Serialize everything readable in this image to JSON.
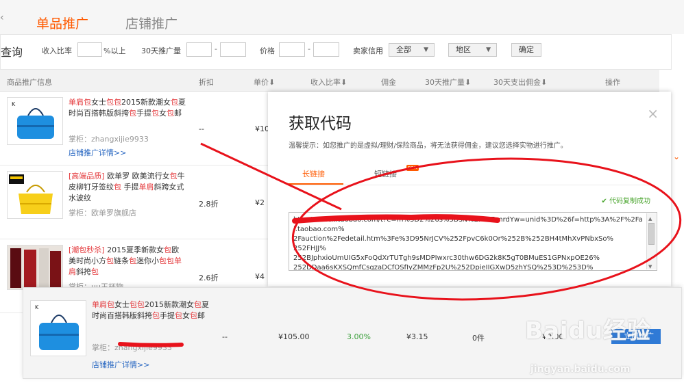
{
  "tabs": {
    "active": "单品推广",
    "inactive": "店铺推广"
  },
  "filters": {
    "query": "查询",
    "income_label": "收入比率",
    "income_suffix": "%以上",
    "promo30_label": "30天推广量",
    "dash": "-",
    "price_label": "价格",
    "seller_label": "卖家信用",
    "seller_value": "全部",
    "region_value": "地区",
    "confirm": "确定"
  },
  "table_header": {
    "info": "商品推广信息",
    "discount": "折扣",
    "price": "单价⬇",
    "income_ratio": "收入比率⬇",
    "commission": "佣金",
    "promo30": "30天推广量⬇",
    "spend30": "30天支出佣金⬇",
    "action": "操作"
  },
  "rows": [
    {
      "title_a": "单肩包",
      "title_b": "女士",
      "title_c": "包包",
      "title_d": "2015新款潮女",
      "title_e": "包",
      "title_f": "夏时尚百搭韩版斜挎",
      "title_g": "包",
      "title_h": "手提",
      "title_i": "包",
      "title_j": "女",
      "title_k": "包",
      "title_l": "邮",
      "shop": "掌柜：zhangxijie9933",
      "link": "店铺推广详情>>",
      "discount": "--",
      "price": "¥10"
    },
    {
      "title_a": "[高端品质]",
      "title_b": " 欧单罗 欧美流行女",
      "title_c": "包",
      "title_d": "牛皮柳钉牙签纹",
      "title_e": "包",
      "title_f": " 手提",
      "title_g": "单肩",
      "title_h": "斜跨",
      "title_i": "女式水波纹",
      "shop": "掌柜：欧单罗旗舰店",
      "discount": "2.8折",
      "price": "¥2"
    },
    {
      "title_a": "[潮包秒杀]",
      "title_b": " 2015夏季新款女",
      "title_c": "包",
      "title_d": "欧美时尚小方",
      "title_e": "包",
      "title_f": "链条",
      "title_g": "包",
      "title_h": "迷你小",
      "title_i": "包包",
      "title_j": "单肩",
      "title_k": "斜挎",
      "title_l": "包",
      "shop": "掌柜：uu王杯物",
      "discount": "2.6折",
      "price": "¥4"
    }
  ],
  "modal": {
    "title": "获取代码",
    "close": "×",
    "tip": "温馨提示：如您推广的是虚拟/理财/保险商品，将无法获得佣金，建议您选择实物进行推广。",
    "tab_long": "长链接",
    "tab_short": "短链接",
    "new_badge": "new",
    "success": "代码复制成功",
    "code_line1": "http://s.click.taobao.com/t?e=m%3D2%26s%3DsN%2FfwTrmrdYw=unid%3D%26f=http%3A%2F%2Fai.taobao.com%",
    "code_line2": "2Fauction%2Fedetail.htm%3Fe%3D95NrJCV%252FpvC6k0Or%252B%252BH4tMhXvPNbxSo%",
    "code_line3": "252FHJJ%",
    "code_line4": "252BJphxioUmUIG5xFoQdXrTUTgh9sMDPIwxrc30thw6DG2k8K5gT0BMuES1GPNxpOE26%",
    "code_line5": "252DDaa6sKXSQmfCsgzaDCfOSfIyZMMzFp2U%252DpieIIGXwD5zhYSQ%253D%253D%"
  },
  "float_row": {
    "title_a": "单肩包",
    "title_b": "女士",
    "title_c": "包包",
    "title_d": "2015新款潮女",
    "title_e": "包",
    "title_f": "夏时尚百搭韩版斜挎",
    "title_g": "包",
    "title_h": "手提",
    "title_i": "包",
    "title_j": "女",
    "title_k": "包",
    "title_l": "邮",
    "shop": "掌柜：zhangxijie9933",
    "link": "店铺推广详情>>",
    "discount": "--",
    "price": "¥105.00",
    "income_ratio": "3.00%",
    "commission": "¥3.15",
    "promo30": "0件",
    "spend30": "¥0.00",
    "action": "立即推广"
  },
  "watermark": {
    "main": "Baidu经验",
    "sub": "jingyan.baidu.com"
  },
  "colors": {
    "accent": "#ff5a00",
    "link": "#2a68c2",
    "highlight": "#e4393c",
    "green": "#3a9f3a",
    "annotation": "#e8121b"
  }
}
